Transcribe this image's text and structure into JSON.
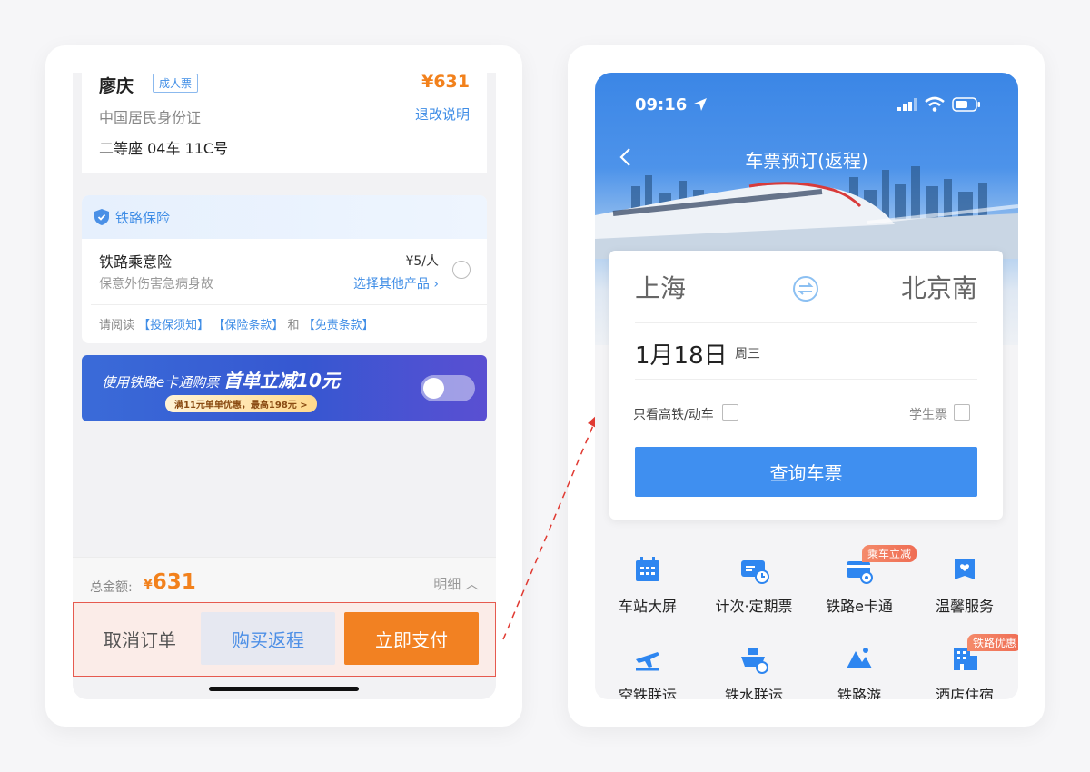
{
  "left_screen": {
    "passenger": {
      "name": "廖庆",
      "ticket_type": "成人票",
      "price": "¥631",
      "id_type": "中国居民身份证",
      "refund_link": "退改说明",
      "seat": "二等座 04车 11C号"
    },
    "insurance": {
      "header": "铁路保险",
      "product_name": "铁路乘意险",
      "product_desc": "保意外伤害急病身故",
      "price": "¥5/人",
      "other_products": "选择其他产品 ›",
      "terms_prefix": "请阅读",
      "term1": "【投保须知】",
      "term2": "【保险条款】",
      "terms_and": "和",
      "term3": "【免责条款】"
    },
    "banner": {
      "text_prefix": "使用铁路",
      "text_brand": "e卡通购票",
      "text_main": "首单立减10元",
      "subtext": "满11元单单优惠，最高198元 >"
    },
    "total": {
      "label": "总金额:",
      "currency": "¥",
      "amount": "631",
      "detail": "明细 ︿"
    },
    "actions": {
      "cancel": "取消订单",
      "buy_return": "购买返程",
      "pay_now": "立即支付"
    }
  },
  "right_screen": {
    "status_bar": {
      "time": "09:16"
    },
    "nav_title": "车票预订(返程)",
    "search": {
      "from": "上海",
      "to": "北京南",
      "date": "1月18日",
      "weekday": "周三",
      "high_speed_only": "只看高铁/动车",
      "student_ticket": "学生票",
      "search_button": "查询车票"
    },
    "services": [
      {
        "label": "车站大屏",
        "icon": "calendar-icon",
        "badge": ""
      },
      {
        "label": "计次·定期票",
        "icon": "ticket-card-icon",
        "badge": ""
      },
      {
        "label": "铁路e卡通",
        "icon": "ecard-icon",
        "badge": "乘车立减"
      },
      {
        "label": "温馨服务",
        "icon": "heart-bag-icon",
        "badge": ""
      },
      {
        "label": "空铁联运",
        "icon": "plane-icon",
        "badge": ""
      },
      {
        "label": "铁水联运",
        "icon": "ship-icon",
        "badge": ""
      },
      {
        "label": "铁路游",
        "icon": "mountain-icon",
        "badge": ""
      },
      {
        "label": "酒店住宿",
        "icon": "hotel-icon",
        "badge": "铁路优惠"
      }
    ]
  },
  "colors": {
    "accent_blue": "#3f8ff0",
    "accent_orange": "#f28122",
    "highlight_red": "#e65a4f"
  }
}
